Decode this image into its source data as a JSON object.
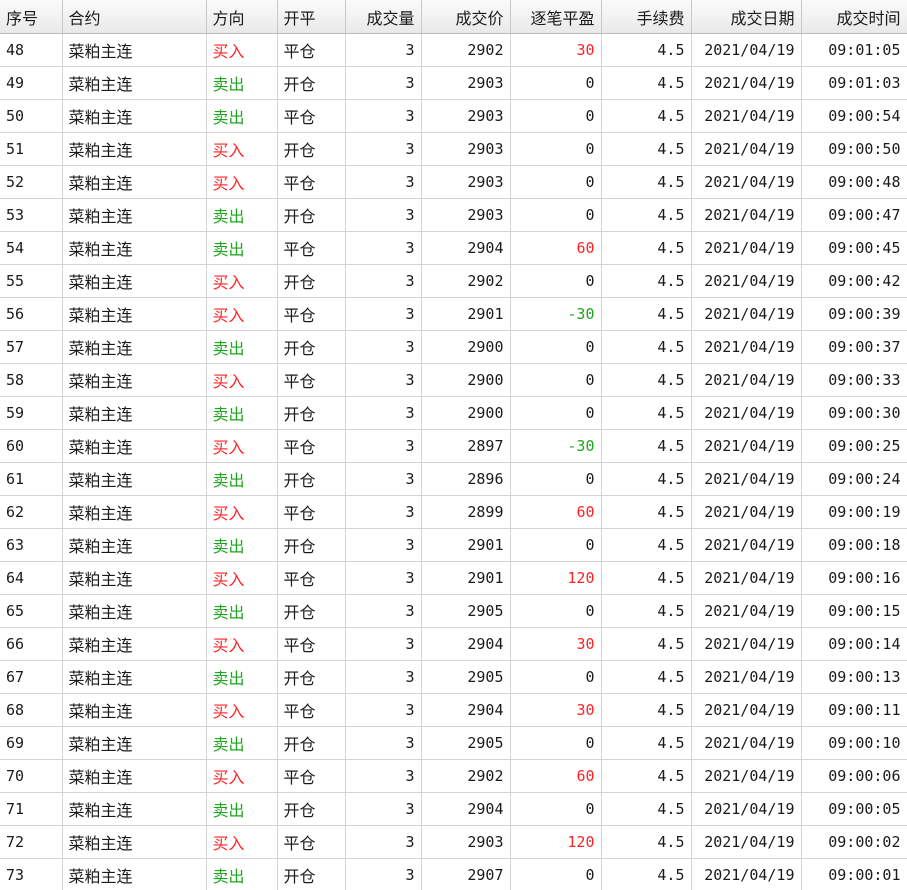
{
  "colors": {
    "buy": "#ff2424",
    "sell": "#1fa51f",
    "header_bg": "#eeeeee",
    "grid_line": "#d4d4d4"
  },
  "columns": [
    "序号",
    "合约",
    "方向",
    "开平",
    "成交量",
    "成交价",
    "逐笔平盈",
    "手续费",
    "成交日期",
    "成交时间"
  ],
  "rows": [
    {
      "seq": "48",
      "contract": "菜粕主连",
      "direction": "买入",
      "offset": "平仓",
      "volume": "3",
      "price": "2902",
      "pnl": "30",
      "fee": "4.5",
      "date": "2021/04/19",
      "time": "09:01:05"
    },
    {
      "seq": "49",
      "contract": "菜粕主连",
      "direction": "卖出",
      "offset": "开仓",
      "volume": "3",
      "price": "2903",
      "pnl": "0",
      "fee": "4.5",
      "date": "2021/04/19",
      "time": "09:01:03"
    },
    {
      "seq": "50",
      "contract": "菜粕主连",
      "direction": "卖出",
      "offset": "平仓",
      "volume": "3",
      "price": "2903",
      "pnl": "0",
      "fee": "4.5",
      "date": "2021/04/19",
      "time": "09:00:54"
    },
    {
      "seq": "51",
      "contract": "菜粕主连",
      "direction": "买入",
      "offset": "开仓",
      "volume": "3",
      "price": "2903",
      "pnl": "0",
      "fee": "4.5",
      "date": "2021/04/19",
      "time": "09:00:50"
    },
    {
      "seq": "52",
      "contract": "菜粕主连",
      "direction": "买入",
      "offset": "平仓",
      "volume": "3",
      "price": "2903",
      "pnl": "0",
      "fee": "4.5",
      "date": "2021/04/19",
      "time": "09:00:48"
    },
    {
      "seq": "53",
      "contract": "菜粕主连",
      "direction": "卖出",
      "offset": "开仓",
      "volume": "3",
      "price": "2903",
      "pnl": "0",
      "fee": "4.5",
      "date": "2021/04/19",
      "time": "09:00:47"
    },
    {
      "seq": "54",
      "contract": "菜粕主连",
      "direction": "卖出",
      "offset": "平仓",
      "volume": "3",
      "price": "2904",
      "pnl": "60",
      "fee": "4.5",
      "date": "2021/04/19",
      "time": "09:00:45"
    },
    {
      "seq": "55",
      "contract": "菜粕主连",
      "direction": "买入",
      "offset": "开仓",
      "volume": "3",
      "price": "2902",
      "pnl": "0",
      "fee": "4.5",
      "date": "2021/04/19",
      "time": "09:00:42"
    },
    {
      "seq": "56",
      "contract": "菜粕主连",
      "direction": "买入",
      "offset": "平仓",
      "volume": "3",
      "price": "2901",
      "pnl": "-30",
      "fee": "4.5",
      "date": "2021/04/19",
      "time": "09:00:39"
    },
    {
      "seq": "57",
      "contract": "菜粕主连",
      "direction": "卖出",
      "offset": "开仓",
      "volume": "3",
      "price": "2900",
      "pnl": "0",
      "fee": "4.5",
      "date": "2021/04/19",
      "time": "09:00:37"
    },
    {
      "seq": "58",
      "contract": "菜粕主连",
      "direction": "买入",
      "offset": "平仓",
      "volume": "3",
      "price": "2900",
      "pnl": "0",
      "fee": "4.5",
      "date": "2021/04/19",
      "time": "09:00:33"
    },
    {
      "seq": "59",
      "contract": "菜粕主连",
      "direction": "卖出",
      "offset": "开仓",
      "volume": "3",
      "price": "2900",
      "pnl": "0",
      "fee": "4.5",
      "date": "2021/04/19",
      "time": "09:00:30"
    },
    {
      "seq": "60",
      "contract": "菜粕主连",
      "direction": "买入",
      "offset": "平仓",
      "volume": "3",
      "price": "2897",
      "pnl": "-30",
      "fee": "4.5",
      "date": "2021/04/19",
      "time": "09:00:25"
    },
    {
      "seq": "61",
      "contract": "菜粕主连",
      "direction": "卖出",
      "offset": "开仓",
      "volume": "3",
      "price": "2896",
      "pnl": "0",
      "fee": "4.5",
      "date": "2021/04/19",
      "time": "09:00:24"
    },
    {
      "seq": "62",
      "contract": "菜粕主连",
      "direction": "买入",
      "offset": "平仓",
      "volume": "3",
      "price": "2899",
      "pnl": "60",
      "fee": "4.5",
      "date": "2021/04/19",
      "time": "09:00:19"
    },
    {
      "seq": "63",
      "contract": "菜粕主连",
      "direction": "卖出",
      "offset": "开仓",
      "volume": "3",
      "price": "2901",
      "pnl": "0",
      "fee": "4.5",
      "date": "2021/04/19",
      "time": "09:00:18"
    },
    {
      "seq": "64",
      "contract": "菜粕主连",
      "direction": "买入",
      "offset": "平仓",
      "volume": "3",
      "price": "2901",
      "pnl": "120",
      "fee": "4.5",
      "date": "2021/04/19",
      "time": "09:00:16"
    },
    {
      "seq": "65",
      "contract": "菜粕主连",
      "direction": "卖出",
      "offset": "开仓",
      "volume": "3",
      "price": "2905",
      "pnl": "0",
      "fee": "4.5",
      "date": "2021/04/19",
      "time": "09:00:15"
    },
    {
      "seq": "66",
      "contract": "菜粕主连",
      "direction": "买入",
      "offset": "平仓",
      "volume": "3",
      "price": "2904",
      "pnl": "30",
      "fee": "4.5",
      "date": "2021/04/19",
      "time": "09:00:14"
    },
    {
      "seq": "67",
      "contract": "菜粕主连",
      "direction": "卖出",
      "offset": "开仓",
      "volume": "3",
      "price": "2905",
      "pnl": "0",
      "fee": "4.5",
      "date": "2021/04/19",
      "time": "09:00:13"
    },
    {
      "seq": "68",
      "contract": "菜粕主连",
      "direction": "买入",
      "offset": "平仓",
      "volume": "3",
      "price": "2904",
      "pnl": "30",
      "fee": "4.5",
      "date": "2021/04/19",
      "time": "09:00:11"
    },
    {
      "seq": "69",
      "contract": "菜粕主连",
      "direction": "卖出",
      "offset": "开仓",
      "volume": "3",
      "price": "2905",
      "pnl": "0",
      "fee": "4.5",
      "date": "2021/04/19",
      "time": "09:00:10"
    },
    {
      "seq": "70",
      "contract": "菜粕主连",
      "direction": "买入",
      "offset": "平仓",
      "volume": "3",
      "price": "2902",
      "pnl": "60",
      "fee": "4.5",
      "date": "2021/04/19",
      "time": "09:00:06"
    },
    {
      "seq": "71",
      "contract": "菜粕主连",
      "direction": "卖出",
      "offset": "开仓",
      "volume": "3",
      "price": "2904",
      "pnl": "0",
      "fee": "4.5",
      "date": "2021/04/19",
      "time": "09:00:05"
    },
    {
      "seq": "72",
      "contract": "菜粕主连",
      "direction": "买入",
      "offset": "平仓",
      "volume": "3",
      "price": "2903",
      "pnl": "120",
      "fee": "4.5",
      "date": "2021/04/19",
      "time": "09:00:02"
    },
    {
      "seq": "73",
      "contract": "菜粕主连",
      "direction": "卖出",
      "offset": "开仓",
      "volume": "3",
      "price": "2907",
      "pnl": "0",
      "fee": "4.5",
      "date": "2021/04/19",
      "time": "09:00:01"
    }
  ]
}
